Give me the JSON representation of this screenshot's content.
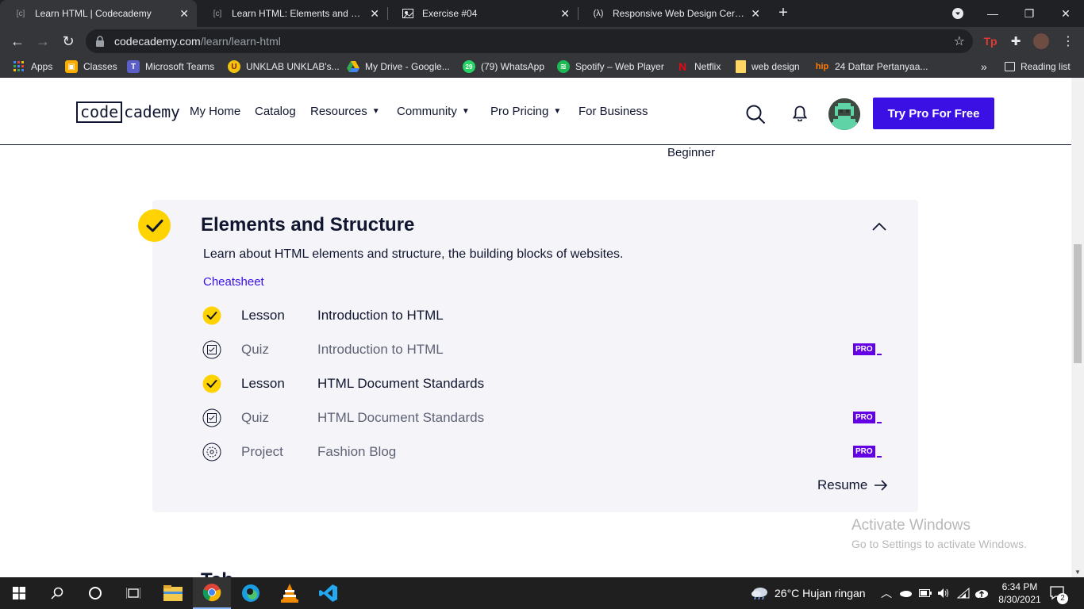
{
  "browser": {
    "tabs": [
      {
        "title": "Learn HTML | Codecademy",
        "active": true
      },
      {
        "title": "Learn HTML: Elements and Struct",
        "active": false
      },
      {
        "title": "Exercise #04",
        "active": false
      },
      {
        "title": "Responsive Web Design Certifica",
        "active": false
      }
    ],
    "url_host": "codecademy.com",
    "url_path": "/learn/learn-html",
    "bookmarks": [
      {
        "label": "Apps",
        "icon": "apps-grid-icon"
      },
      {
        "label": "Classes",
        "icon": "classroom-icon"
      },
      {
        "label": "Microsoft Teams",
        "icon": "teams-icon"
      },
      {
        "label": "UNKLAB UNKLAB's...",
        "icon": "unklab-icon"
      },
      {
        "label": "My Drive - Google...",
        "icon": "google-drive-icon"
      },
      {
        "label": "(79) WhatsApp",
        "icon": "whatsapp-icon"
      },
      {
        "label": "Spotify – Web Player",
        "icon": "spotify-icon"
      },
      {
        "label": "Netflix",
        "icon": "netflix-icon"
      },
      {
        "label": "web design",
        "icon": "folder-icon"
      },
      {
        "label": "24 Daftar Pertanyaa...",
        "icon": "hip-icon"
      }
    ],
    "reading_list": "Reading list"
  },
  "header": {
    "nav": [
      {
        "label": "My Home",
        "dropdown": false
      },
      {
        "label": "Catalog",
        "dropdown": false
      },
      {
        "label": "Resources",
        "dropdown": true
      },
      {
        "label": "Community",
        "dropdown": true
      },
      {
        "label": "Pro Pricing",
        "dropdown": true
      },
      {
        "label": "For Business",
        "dropdown": false
      }
    ],
    "cta": "Try Pro For Free"
  },
  "level": "Beginner",
  "module": {
    "title": "Elements and Structure",
    "description": "Learn about HTML elements and structure, the building blocks of websites.",
    "cheatsheet": "Cheatsheet",
    "items": [
      {
        "kind": "Lesson",
        "name": "Introduction to HTML",
        "status": "complete",
        "pro": false
      },
      {
        "kind": "Quiz",
        "name": "Introduction to HTML",
        "status": "quiz",
        "pro": true
      },
      {
        "kind": "Lesson",
        "name": "HTML Document Standards",
        "status": "complete",
        "pro": false
      },
      {
        "kind": "Quiz",
        "name": "HTML Document Standards",
        "status": "quiz",
        "pro": true
      },
      {
        "kind": "Project",
        "name": "Fashion Blog",
        "status": "project",
        "pro": true
      }
    ],
    "pro_label": "PRO",
    "resume": "Resume"
  },
  "next_module_peek": "Tab",
  "activate_windows": {
    "line1": "Activate Windows",
    "line2": "Go to Settings to activate Windows."
  },
  "taskbar": {
    "weather": "26°C  Hujan ringan",
    "time": "6:34 PM",
    "date": "8/30/2021",
    "notifications": "2"
  },
  "colors": {
    "brand_navy": "#10162f",
    "brand_purple": "#3a10e5",
    "check_yellow": "#ffd300",
    "pro_purple": "#6400e4"
  }
}
